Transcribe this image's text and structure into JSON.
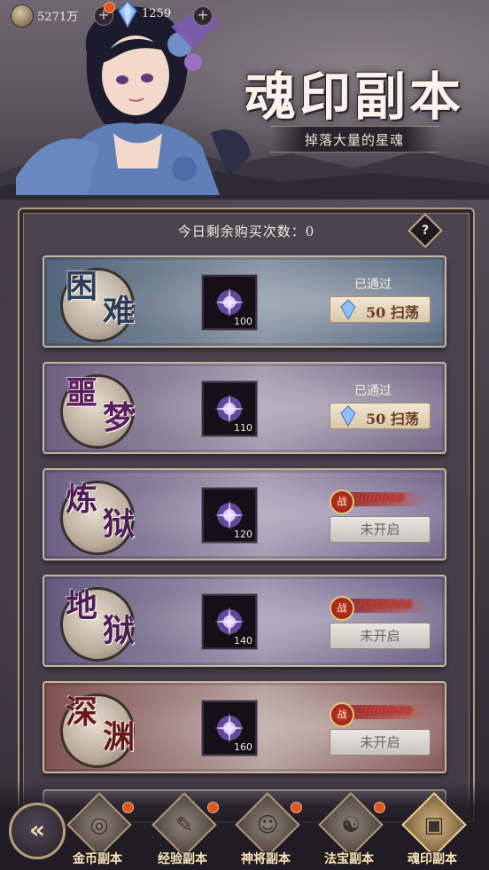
{
  "topbar": {
    "gold": "5271万",
    "gems": "1259"
  },
  "header": {
    "title": "魂印副本",
    "subtitle": "掉落大量的星魂"
  },
  "panel": {
    "buy_label": "今日剩余购买次数：0",
    "help_label": "?"
  },
  "colors": {
    "row_kunnan": "#51647a",
    "row_emeng": "#6e5f80",
    "row_lianyu": "#6b5f83",
    "row_diyu": "#625a7c",
    "row_shenyuan": "#7f5250",
    "power_red": "#d8382a"
  },
  "stages": [
    {
      "name_top": "困",
      "name_bottom": "难",
      "name_color": "#2d3c57",
      "qty": "100",
      "passed": "已通过",
      "sweep": "50 扫荡"
    },
    {
      "name_top": "噩",
      "name_bottom": "梦",
      "name_color": "#5b1d5e",
      "qty": "110",
      "passed": "已通过",
      "sweep": "50 扫荡"
    },
    {
      "name_top": "炼",
      "name_bottom": "狱",
      "name_color": "#4e1d55",
      "qty": "120",
      "power_seal": "战",
      "power": "800000",
      "locked": "未开启"
    },
    {
      "name_top": "地",
      "name_bottom": "狱",
      "name_color": "#4e1d55",
      "qty": "140",
      "power_seal": "战",
      "power": "1240000",
      "locked": "未开启"
    },
    {
      "name_top": "深",
      "name_bottom": "渊",
      "name_color": "#6a1718",
      "qty": "160",
      "power_seal": "战",
      "power": "2000000",
      "locked": "未开启"
    }
  ],
  "nav": {
    "back": "«",
    "tabs": [
      {
        "label": "金币副本",
        "icon": "coins-icon",
        "glyph": "◎"
      },
      {
        "label": "经验副本",
        "icon": "scroll-icon",
        "glyph": "✎"
      },
      {
        "label": "神将副本",
        "icon": "general-icon",
        "glyph": "☺"
      },
      {
        "label": "法宝副本",
        "icon": "yin-yang-icon",
        "glyph": "☯"
      },
      {
        "label": "魂印副本",
        "icon": "soul-card-icon",
        "glyph": "▣"
      }
    ]
  }
}
